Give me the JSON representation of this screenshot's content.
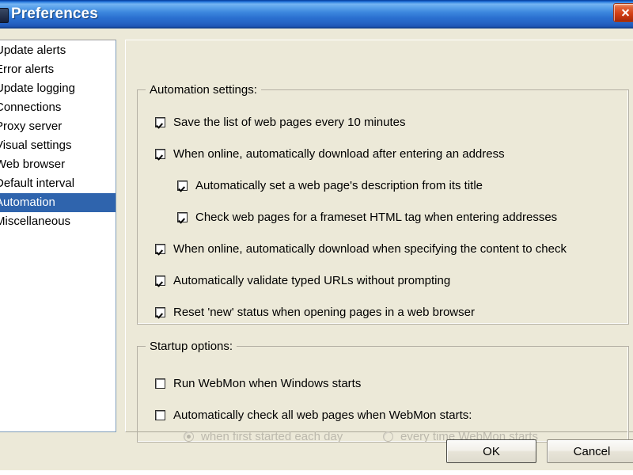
{
  "window": {
    "title": "Preferences",
    "icon": "app-icon",
    "close_label": "✕",
    "titlebar_color": "#2a6fd0",
    "face_color": "#ece9d8",
    "selection_color": "#2f64ad"
  },
  "sidebar": {
    "items": [
      {
        "label": "Update alerts",
        "selected": false
      },
      {
        "label": "Error alerts",
        "selected": false
      },
      {
        "label": "Update logging",
        "selected": false
      },
      {
        "label": "Connections",
        "selected": false
      },
      {
        "label": "Proxy server",
        "selected": false
      },
      {
        "label": "Visual settings",
        "selected": false
      },
      {
        "label": "Web browser",
        "selected": false
      },
      {
        "label": "Default interval",
        "selected": false
      },
      {
        "label": "Automation",
        "selected": true
      },
      {
        "label": "Miscellaneous",
        "selected": false
      }
    ]
  },
  "automation_group": {
    "legend": "Automation settings:",
    "checkboxes": [
      {
        "label": "Save the list of web pages every 10 minutes",
        "checked": true,
        "indent": 0
      },
      {
        "label": "When online, automatically download after entering an address",
        "checked": true,
        "indent": 0
      },
      {
        "label": "Automatically set a web page's description from its title",
        "checked": true,
        "indent": 1
      },
      {
        "label": "Check web pages for a frameset HTML tag when entering addresses",
        "checked": true,
        "indent": 1
      },
      {
        "label": "When online, automatically download when specifying the content to check",
        "checked": true,
        "indent": 0
      },
      {
        "label": "Automatically validate typed URLs without prompting",
        "checked": true,
        "indent": 0
      },
      {
        "label": "Reset 'new' status when opening pages in a web browser",
        "checked": true,
        "indent": 0
      }
    ]
  },
  "startup_group": {
    "legend": "Startup options:",
    "checkboxes": [
      {
        "label": "Run WebMon when Windows starts",
        "checked": false
      },
      {
        "label": "Automatically check all web pages when WebMon starts:",
        "checked": false
      }
    ],
    "radios": [
      {
        "label": "when first started each day",
        "selected": true,
        "disabled": true
      },
      {
        "label": "every time WebMon starts",
        "selected": false,
        "disabled": true
      }
    ]
  },
  "buttons": {
    "ok": "OK",
    "cancel": "Cancel"
  }
}
